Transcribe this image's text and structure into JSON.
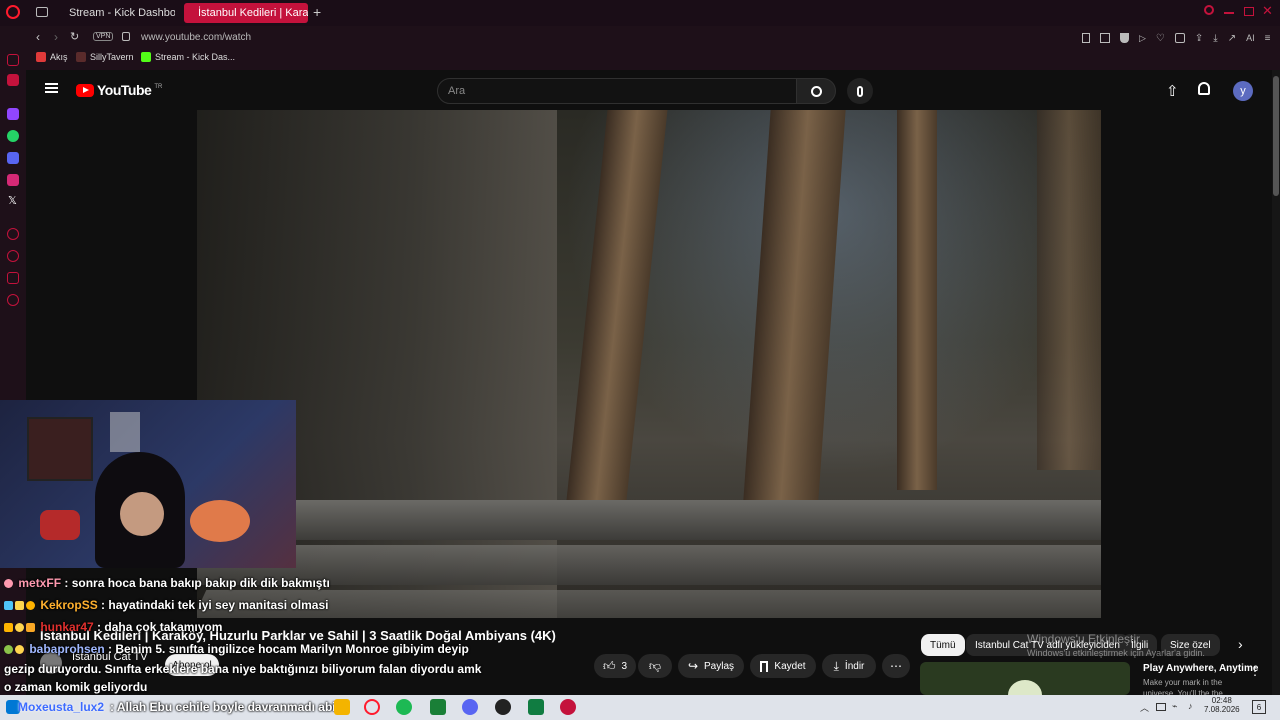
{
  "browser": {
    "tabs": [
      {
        "label": "Stream - Kick Dashboard",
        "active": false
      },
      {
        "label": "İstanbul Kedileri | Karaköy,",
        "active": true
      }
    ],
    "address": "www.youtube.com/watch",
    "vpn_label": "VPN",
    "ai_label": "AI",
    "bookmarks": [
      {
        "label": "Akış",
        "icon": "akis-icon"
      },
      {
        "label": "SillyTavern",
        "icon": "sillytavern-icon"
      },
      {
        "label": "Stream - Kick Das...",
        "icon": "kick-icon"
      }
    ]
  },
  "youtube": {
    "logo_text": "YouTube",
    "logo_sup": "TR",
    "search_placeholder": "Ara",
    "avatar_letter": "y",
    "video_title": "İstanbul Kedileri | Karaköy, Huzurlu Parklar ve Sahil | 3 Saatlik Doğal Ambiyans (4K)",
    "channel_name": "Istanbul Cat TV",
    "subscribe_label": "Abone ol",
    "like_count": "3",
    "share_label": "Paylaş",
    "save_label": "Kaydet",
    "download_label": "İndir",
    "chips": [
      "Tümü",
      "Istanbul Cat TV adlı yükleyiciden",
      "İlgili",
      "Size özel"
    ],
    "recommendation": {
      "title": "Play Anywhere, Anytime",
      "subtitle": "Make your mark in the universe. You'll the the guide"
    }
  },
  "windows_activation": {
    "line1": "Windows'u Etkinleştir",
    "line2": "Windows'u etkinleştirmek için Ayarlar'a gidin."
  },
  "chat": [
    {
      "user": "metxFF",
      "message": ": sonra hoca bana bakıp bakıp dik dik bakmıştı",
      "color": "#ff9ab0"
    },
    {
      "user": "KekropSS",
      "message": ": hayatindaki tek iyi sey manitasi olmasi",
      "color": "#ffb02e"
    },
    {
      "user": "hunkar47",
      "message": ": daha çok takamıyom",
      "color": "#e0302e"
    },
    {
      "user": "babaprohsen",
      "message": ": Benim 5. sınıfta ingilizce hocam Marilyn Monroe gibiyim deyip",
      "color": "#a0b8ff"
    },
    {
      "user": "",
      "message": "gezip duruyordu. Sınıfta erkeklere bana niye baktığınızı biliyorum falan diyordu amk",
      "color": "#ffffff"
    },
    {
      "user": "",
      "message": "o zaman komik geliyordu",
      "color": "#ffffff"
    },
    {
      "user": "Moxeusta_lux2",
      "message": ": Allah Ebu cehile boyle davranmadı abi",
      "color": "#3d6bff"
    }
  ],
  "taskbar": {
    "time": "02:48",
    "date": "7.08.2026",
    "notification_count": "6"
  }
}
